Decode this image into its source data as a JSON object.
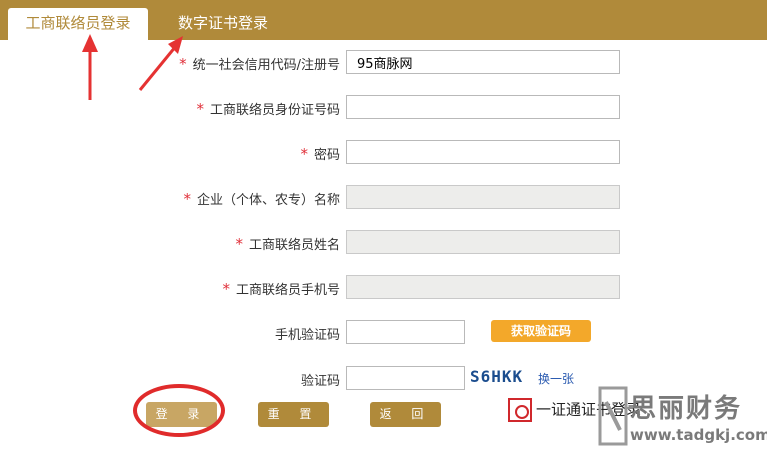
{
  "tabs": [
    {
      "label": "工商联络员登录",
      "active": true
    },
    {
      "label": "数字证书登录",
      "active": false
    }
  ],
  "form": {
    "required_mark": "*",
    "fields": [
      {
        "label": "统一社会信用代码/注册号",
        "required": true,
        "value": "95商脉网",
        "disabled": false
      },
      {
        "label": "工商联络员身份证号码",
        "required": true,
        "value": "",
        "disabled": false
      },
      {
        "label": "密码",
        "required": true,
        "value": "",
        "disabled": false
      },
      {
        "label": "企业（个体、农专）名称",
        "required": true,
        "value": "",
        "disabled": true
      },
      {
        "label": "工商联络员姓名",
        "required": true,
        "value": "",
        "disabled": true
      },
      {
        "label": "工商联络员手机号",
        "required": true,
        "value": "",
        "disabled": true
      },
      {
        "label": "手机验证码",
        "required": false,
        "value": ""
      },
      {
        "label": "验证码",
        "required": false,
        "value": ""
      }
    ],
    "sms_button": "获取验证码",
    "captcha_text": "S6HKK",
    "captcha_refresh": "换一张"
  },
  "buttons": {
    "login": "登 录",
    "reset": "重 置",
    "back": "返 回"
  },
  "cert_login_text": "一证通证书登录",
  "watermark": {
    "name": "思丽财务",
    "url": "www.tadgkj.com"
  },
  "colors": {
    "brand": "#b08a3a",
    "accent_button": "#f3a82a",
    "required": "#e0303a",
    "annotation": "#e02b2b"
  }
}
